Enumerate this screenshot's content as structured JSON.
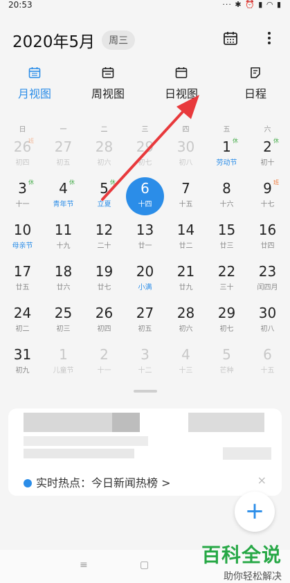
{
  "status": {
    "time": "20:53",
    "icons": "··· ✱ ⏰ ▮ ◠ ▮"
  },
  "header": {
    "title": "2020年5月",
    "weekday": "周三"
  },
  "tabs": [
    {
      "label": "月视图",
      "icon": "month-view-icon",
      "active": true
    },
    {
      "label": "周视图",
      "icon": "week-view-icon",
      "active": false
    },
    {
      "label": "日视图",
      "icon": "day-view-icon",
      "active": false
    },
    {
      "label": "日程",
      "icon": "schedule-icon",
      "active": false
    }
  ],
  "weekdays": [
    "日",
    "一",
    "二",
    "三",
    "四",
    "五",
    "六"
  ],
  "weeks": [
    [
      {
        "n": "26",
        "s": "初四",
        "other": true,
        "badge": "班"
      },
      {
        "n": "27",
        "s": "初五",
        "other": true
      },
      {
        "n": "28",
        "s": "初六",
        "other": true
      },
      {
        "n": "29",
        "s": "初七",
        "other": true
      },
      {
        "n": "30",
        "s": "初八",
        "other": true
      },
      {
        "n": "1",
        "s": "劳动节",
        "blue": true,
        "badge": "休"
      },
      {
        "n": "2",
        "s": "初十",
        "badge": "休"
      }
    ],
    [
      {
        "n": "3",
        "s": "十一",
        "badge": "休"
      },
      {
        "n": "4",
        "s": "青年节",
        "blue": true,
        "badge": "休"
      },
      {
        "n": "5",
        "s": "立夏",
        "blue": true,
        "badge": "休"
      },
      {
        "n": "6",
        "s": "十四",
        "today": true
      },
      {
        "n": "7",
        "s": "十五"
      },
      {
        "n": "8",
        "s": "十六"
      },
      {
        "n": "9",
        "s": "十七",
        "badge": "班"
      }
    ],
    [
      {
        "n": "10",
        "s": "母亲节",
        "blue": true
      },
      {
        "n": "11",
        "s": "十九"
      },
      {
        "n": "12",
        "s": "二十"
      },
      {
        "n": "13",
        "s": "廿一"
      },
      {
        "n": "14",
        "s": "廿二"
      },
      {
        "n": "15",
        "s": "廿三"
      },
      {
        "n": "16",
        "s": "廿四"
      }
    ],
    [
      {
        "n": "17",
        "s": "廿五"
      },
      {
        "n": "18",
        "s": "廿六"
      },
      {
        "n": "19",
        "s": "廿七"
      },
      {
        "n": "20",
        "s": "小满",
        "blue": true
      },
      {
        "n": "21",
        "s": "廿九"
      },
      {
        "n": "22",
        "s": "三十"
      },
      {
        "n": "23",
        "s": "闰四月"
      }
    ],
    [
      {
        "n": "24",
        "s": "初二"
      },
      {
        "n": "25",
        "s": "初三"
      },
      {
        "n": "26",
        "s": "初四"
      },
      {
        "n": "27",
        "s": "初五"
      },
      {
        "n": "28",
        "s": "初六"
      },
      {
        "n": "29",
        "s": "初七"
      },
      {
        "n": "30",
        "s": "初八"
      }
    ],
    [
      {
        "n": "31",
        "s": "初九"
      },
      {
        "n": "1",
        "s": "儿童节",
        "other": true
      },
      {
        "n": "2",
        "s": "十一",
        "other": true
      },
      {
        "n": "3",
        "s": "十二",
        "other": true
      },
      {
        "n": "4",
        "s": "十三",
        "other": true
      },
      {
        "n": "5",
        "s": "芒种",
        "other": true
      },
      {
        "n": "6",
        "s": "十五",
        "other": true
      }
    ]
  ],
  "card": {
    "hot_text": "实时热点：今日新闻热榜 >",
    "close": "×"
  },
  "fab": {
    "label": "+"
  },
  "navbar": {
    "menu": "≡",
    "home": "▢"
  },
  "watermark": {
    "big": "百科全说",
    "small": "助你轻松解决"
  },
  "colors": {
    "accent": "#2b8de8",
    "holiday": "#4caf50",
    "workday": "#f07a3a",
    "arrow": "#e8393c"
  }
}
